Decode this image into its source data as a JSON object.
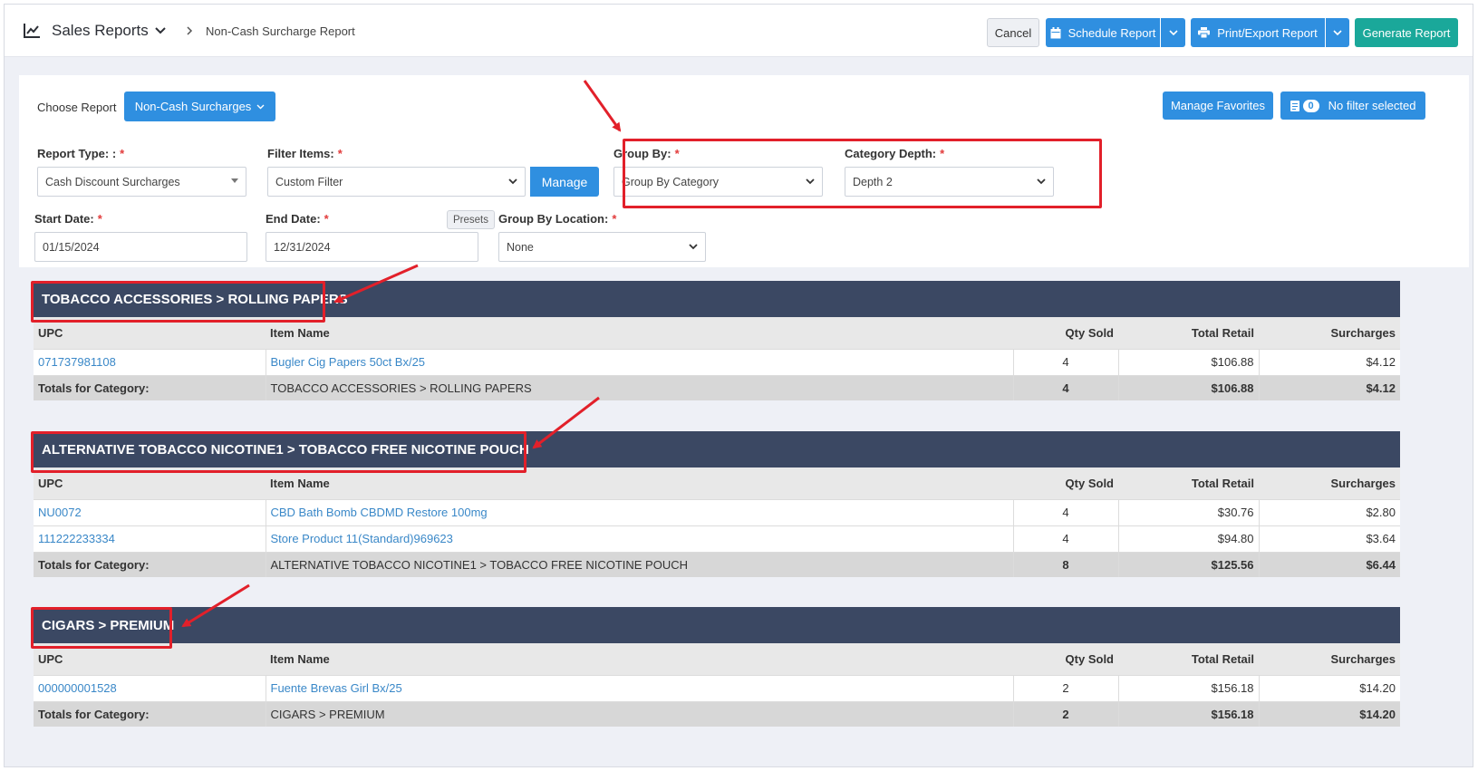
{
  "header": {
    "title": "Sales Reports",
    "breadcrumb": "Non-Cash Surcharge Report",
    "cancel_label": "Cancel",
    "schedule_label": "Schedule Report",
    "print_label": "Print/Export Report",
    "generate_label": "Generate Report"
  },
  "panel": {
    "choose_label": "Choose Report",
    "report_button": "Non-Cash Surcharges",
    "favorites_label": "Manage Favorites",
    "filter_count": "0",
    "filter_status": "No filter selected",
    "report_type_label": "Report Type: :",
    "report_type_value": "Cash Discount Surcharges",
    "filter_items_label": "Filter Items:",
    "filter_items_value": "Custom Filter",
    "manage_label": "Manage",
    "group_by_label": "Group By:",
    "group_by_value": "Group By Category",
    "category_depth_label": "Category Depth:",
    "category_depth_value": "Depth 2",
    "start_date_label": "Start Date:",
    "start_date_value": "01/15/2024",
    "end_date_label": "End Date:",
    "end_date_value": "12/31/2024",
    "presets_label": "Presets",
    "group_location_label": "Group By Location:",
    "group_location_value": "None",
    "required_mark": "*"
  },
  "columns": {
    "upc": "UPC",
    "item": "Item Name",
    "qty": "Qty Sold",
    "retail": "Total Retail",
    "surcharges": "Surcharges"
  },
  "totals_label": "Totals for Category:",
  "sections": [
    {
      "category": "TOBACCO ACCESSORIES > ROLLING PAPERS",
      "rows": [
        {
          "upc": "071737981108",
          "item": "Bugler Cig Papers 50ct Bx/25",
          "qty": "4",
          "retail": "$106.88",
          "surcharges": "$4.12"
        }
      ],
      "total": {
        "category": "TOBACCO ACCESSORIES > ROLLING PAPERS",
        "qty": "4",
        "retail": "$106.88",
        "surcharges": "$4.12"
      }
    },
    {
      "category": "ALTERNATIVE TOBACCO NICOTINE1 > TOBACCO FREE NICOTINE POUCH",
      "rows": [
        {
          "upc": "NU0072",
          "item": "CBD Bath Bomb CBDMD Restore 100mg",
          "qty": "4",
          "retail": "$30.76",
          "surcharges": "$2.80"
        },
        {
          "upc": "111222233334",
          "item": "Store Product 11(Standard)969623",
          "qty": "4",
          "retail": "$94.80",
          "surcharges": "$3.64"
        }
      ],
      "total": {
        "category": "ALTERNATIVE TOBACCO NICOTINE1 > TOBACCO FREE NICOTINE POUCH",
        "qty": "8",
        "retail": "$125.56",
        "surcharges": "$6.44"
      }
    },
    {
      "category": "CIGARS > PREMIUM",
      "rows": [
        {
          "upc": "000000001528",
          "item": "Fuente Brevas Girl Bx/25",
          "qty": "2",
          "retail": "$156.18",
          "surcharges": "$14.20"
        }
      ],
      "total": {
        "category": "CIGARS > PREMIUM",
        "qty": "2",
        "retail": "$156.18",
        "surcharges": "$14.20"
      }
    }
  ],
  "colors": {
    "primary": "#2f8fe0",
    "success": "#1aa89a",
    "category_bar": "#3b4863",
    "annotation": "#e2202a",
    "link": "#3a88c8"
  }
}
